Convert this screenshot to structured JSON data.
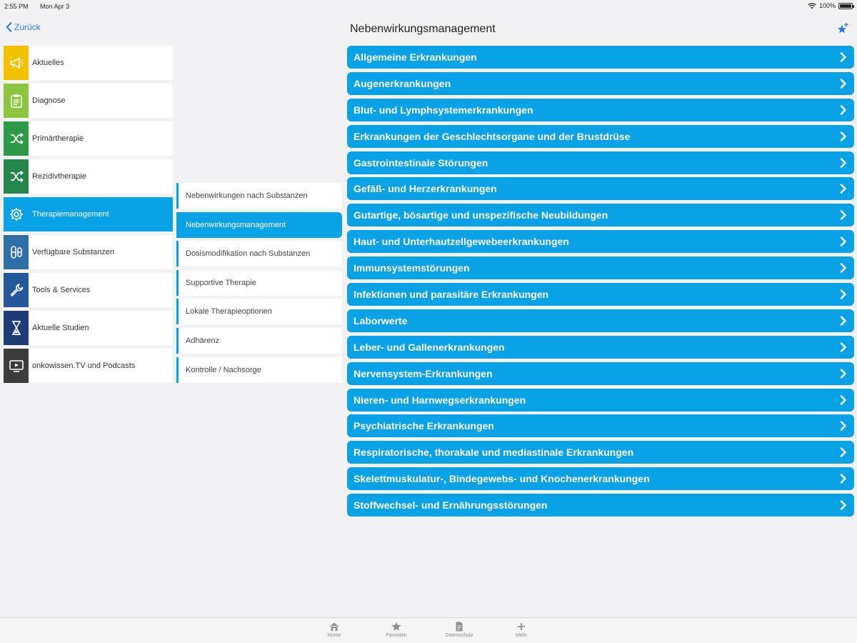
{
  "status": {
    "time": "2:55 PM",
    "date": "Mon Apr 3",
    "battery": "100%",
    "battery_level": 1.0
  },
  "nav": {
    "back_label": "Zurück",
    "title": "Nebenwirkungsmanagement"
  },
  "menu": [
    {
      "label": "Aktuelles",
      "icon": "megaphone-icon",
      "color": "#f2c200"
    },
    {
      "label": "Diagnose",
      "icon": "clipboard-icon",
      "color": "#8cc63e"
    },
    {
      "label": "Primärtherapie",
      "icon": "shuffle-icon",
      "color": "#2e9a48"
    },
    {
      "label": "Rezidivtherapie",
      "icon": "shuffle-icon",
      "color": "#23884a"
    },
    {
      "label": "Therapiemanagement",
      "icon": "gear-icon",
      "color": "#0aa2e6",
      "active": true
    },
    {
      "label": "Verfügbare Substanzen",
      "icon": "pills-icon",
      "color": "#2f6ea6"
    },
    {
      "label": "Tools & Services",
      "icon": "wrench-icon",
      "color": "#25589a"
    },
    {
      "label": "Aktuelle Studien",
      "icon": "hourglass-icon",
      "color": "#1e3c78"
    },
    {
      "label": "onkowissen.TV und Podcasts",
      "icon": "tv-play-icon",
      "color": "#3c3c3c"
    }
  ],
  "submenu": [
    {
      "label": "Nebenwirkungen nach Substanzen"
    },
    {
      "label": "Nebenwirkungsmanagement",
      "active": true
    },
    {
      "label": "Dosismodifikation nach Substanzen"
    },
    {
      "label": "Supportive Therapie"
    },
    {
      "label": "Lokale Therapieoptionen"
    },
    {
      "label": "Adhärenz"
    },
    {
      "label": "Kontrolle / Nachsorge"
    }
  ],
  "list": [
    "Allgemeine Erkrankungen",
    "Augenerkrankungen",
    "Blut- und Lymphsystemerkrankungen",
    "Erkrankungen der Geschlechtsorgane und der Brustdrüse",
    "Gastrointestinale Störungen",
    "Gefäß- und Herzerkrankungen",
    "Gutartige, bösartige und unspezifische Neubildungen",
    "Haut- und Unterhautzellgewebeerkrankungen",
    "Immunsystemstörungen",
    "Infektionen und parasitäre Erkrankungen",
    "Laborwerte",
    "Leber- und Gallenerkrankungen",
    "Nervensystem-Erkrankungen",
    "Nieren- und Harnwegserkrankungen",
    "Psychiatrische Erkrankungen",
    "Respiratorische, thorakale und mediastinale Erkrankungen",
    "Skelettmuskulatur-, Bindegewebs- und Knochenerkrankungen",
    "Stoffwechsel- und Ernährungsstörungen"
  ],
  "tabs": [
    {
      "label": "Home",
      "icon": "home-icon"
    },
    {
      "label": "Favoriten",
      "icon": "star-icon"
    },
    {
      "label": "Datenschutz",
      "icon": "document-icon"
    },
    {
      "label": "Mehr",
      "icon": "plus-icon"
    }
  ],
  "colors": {
    "accent": "#0aa2e6",
    "link": "#2a7ae4",
    "background": "#f2f2f4"
  }
}
